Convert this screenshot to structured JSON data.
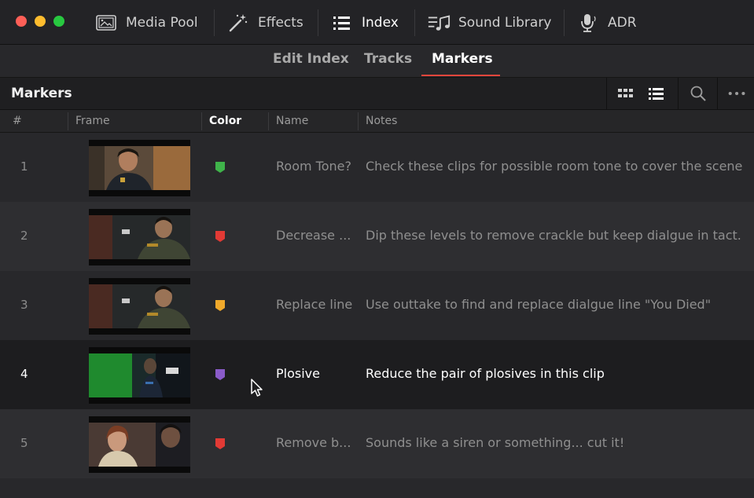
{
  "toolbar": {
    "items": [
      {
        "label": "Media Pool",
        "icon": "media-pool-icon"
      },
      {
        "label": "Effects",
        "icon": "effects-wand-icon"
      },
      {
        "label": "Index",
        "icon": "index-list-icon",
        "active": true
      },
      {
        "label": "Sound Library",
        "icon": "sound-library-icon"
      },
      {
        "label": "ADR",
        "icon": "microphone-icon"
      }
    ]
  },
  "subtabs": {
    "items": [
      "Edit Index",
      "Tracks",
      "Markers"
    ],
    "active": "Markers"
  },
  "panel": {
    "title": "Markers",
    "buttons": [
      "thumbnail-view-icon",
      "list-view-icon",
      "search-icon",
      "more-options-icon"
    ]
  },
  "columns": {
    "num": "#",
    "frame": "Frame",
    "color": "Color",
    "name": "Name",
    "notes": "Notes"
  },
  "rows": [
    {
      "num": "1",
      "color": "#3fb34a",
      "name": "Room Tone?",
      "note": "Check these clips for possible room tone to cover the scene"
    },
    {
      "num": "2",
      "color": "#e23a35",
      "name": "Decrease ...",
      "note": "Dip these levels to remove crackle but keep dialgue in tact."
    },
    {
      "num": "3",
      "color": "#f0a92b",
      "name": "Replace line",
      "note": "Use outtake to find and replace dialgue line \"You Died\""
    },
    {
      "num": "4",
      "color": "#8a5bc9",
      "name": "Plosive",
      "note": "Reduce the pair of plosives in this clip",
      "selected": true
    },
    {
      "num": "5",
      "color": "#e23a35",
      "name": "Remove b...",
      "note": "Sounds like a siren or something... cut it!"
    }
  ]
}
